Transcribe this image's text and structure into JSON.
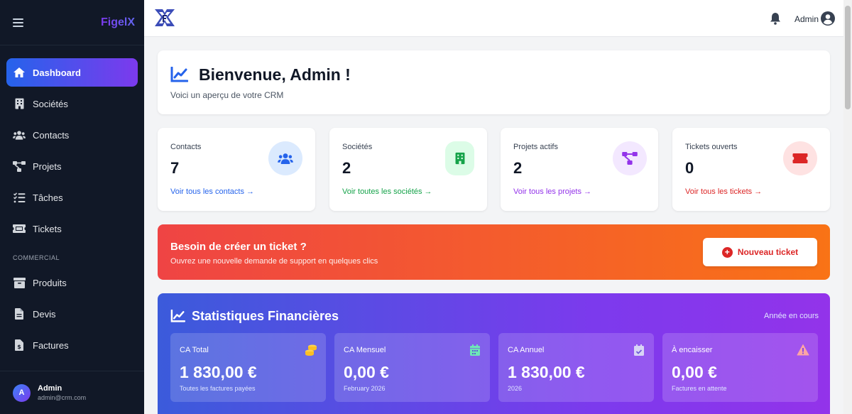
{
  "sidebar": {
    "brand": "FigelX",
    "items": [
      {
        "label": "Dashboard",
        "icon": "home-icon",
        "active": true
      },
      {
        "label": "Sociétés",
        "icon": "building-icon"
      },
      {
        "label": "Contacts",
        "icon": "users-icon"
      },
      {
        "label": "Projets",
        "icon": "project-diagram-icon"
      },
      {
        "label": "Tâches",
        "icon": "tasks-icon"
      },
      {
        "label": "Tickets",
        "icon": "ticket-icon"
      }
    ],
    "section_label": "COMMERCIAL",
    "commercial_items": [
      {
        "label": "Produits",
        "icon": "box-icon"
      },
      {
        "label": "Devis",
        "icon": "file-icon"
      },
      {
        "label": "Factures",
        "icon": "invoice-icon"
      }
    ],
    "user": {
      "initial": "A",
      "name": "Admin",
      "email": "admin@crm.com"
    }
  },
  "topbar": {
    "user_label": "Admin"
  },
  "welcome": {
    "title": "Bienvenue, Admin !",
    "subtitle": "Voici un aperçu de votre CRM"
  },
  "stats": [
    {
      "label": "Contacts",
      "value": "7",
      "link": "Voir tous les contacts →",
      "color": "#2563eb",
      "bg": "#dbeafe",
      "icon": "users-icon"
    },
    {
      "label": "Sociétés",
      "value": "2",
      "link": "Voir toutes les sociétés →",
      "color": "#16a34a",
      "bg": "#dcfce7",
      "icon": "building-icon"
    },
    {
      "label": "Projets actifs",
      "value": "2",
      "link": "Voir tous les projets →",
      "color": "#9333ea",
      "bg": "#f3e8ff",
      "icon": "project-diagram-icon"
    },
    {
      "label": "Tickets ouverts",
      "value": "0",
      "link": "Voir tous les tickets →",
      "color": "#dc2626",
      "bg": "#fee2e2",
      "icon": "ticket-icon"
    }
  ],
  "banner": {
    "title": "Besoin de créer un ticket ?",
    "subtitle": "Ouvrez une nouvelle demande de support en quelques clics",
    "button": "Nouveau ticket"
  },
  "finance": {
    "title": "Statistiques Financières",
    "period": "Année en cours",
    "cards": [
      {
        "label": "CA Total",
        "value": "1 830,00 €",
        "sub": "Toutes les factures payées",
        "icon": "coins-icon"
      },
      {
        "label": "CA Mensuel",
        "value": "0,00 €",
        "sub": "February 2026",
        "icon": "calendar-icon"
      },
      {
        "label": "CA Annuel",
        "value": "1 830,00 €",
        "sub": "2026",
        "icon": "calendar-check-icon"
      },
      {
        "label": "À encaisser",
        "value": "0,00 €",
        "sub": "Factures en attente",
        "icon": "warning-icon"
      }
    ]
  }
}
